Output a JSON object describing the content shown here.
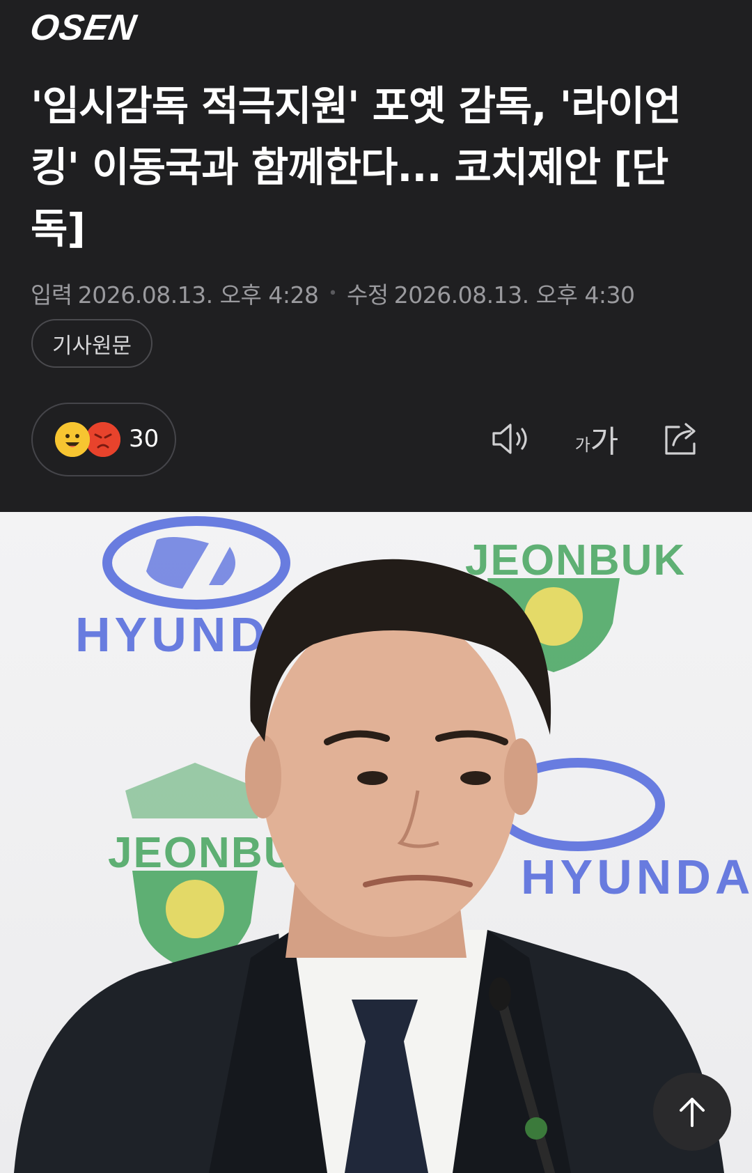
{
  "header": {
    "logo": "OSEN",
    "title": "'임시감독 적극지원' 포옛 감독, '라이언킹' 이동국과 함께한다... 코치제안 [단독]",
    "input_label": "입력",
    "input_date": "2026.08.13. 오후 4:28",
    "edit_label": "수정",
    "edit_date": "2026.08.13. 오후 4:30",
    "source_button": "기사원문"
  },
  "reactions": {
    "count": "30",
    "icons": [
      "happy-emoji",
      "angry-emoji"
    ]
  },
  "toolbar": {
    "speaker_icon": "speaker-icon",
    "font_small": "가",
    "font_big": "가",
    "share_icon": "share-icon"
  },
  "photo": {
    "banner_texts": [
      "HYUNDAI",
      "JEONBUK",
      "JEONBUK",
      "HYUNDAI"
    ],
    "colors": {
      "hyundai_blue": "#3b55d9",
      "jeonbuk_green": "#2e9a4a",
      "jeonbuk_yellow": "#e0d23a"
    }
  },
  "scroll_top_icon": "arrow-up-icon"
}
